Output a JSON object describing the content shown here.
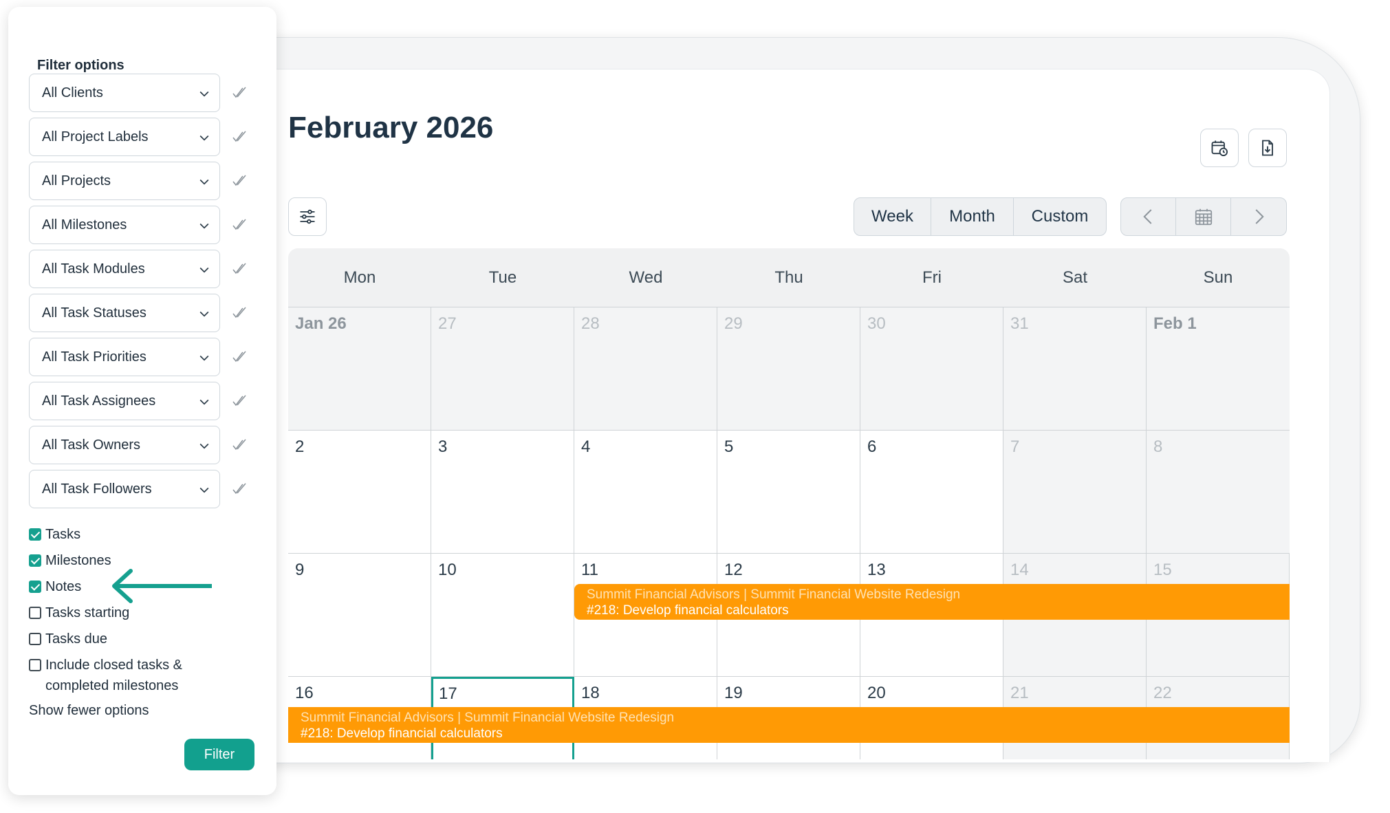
{
  "calendar": {
    "title": "February 2026",
    "views": [
      "Week",
      "Month",
      "Custom"
    ],
    "weekdays": [
      "Mon",
      "Tue",
      "Wed",
      "Thu",
      "Fri",
      "Sat",
      "Sun"
    ],
    "weeks": [
      [
        "Jan 26",
        "27",
        "28",
        "29",
        "30",
        "31",
        "Feb 1"
      ],
      [
        "2",
        "3",
        "4",
        "5",
        "6",
        "7",
        "8"
      ],
      [
        "9",
        "10",
        "11",
        "12",
        "13",
        "14",
        "15"
      ],
      [
        "16",
        "17",
        "18",
        "19",
        "20",
        "21",
        "22"
      ]
    ],
    "events": [
      {
        "line1": "Summit Financial Advisors | Summit Financial Website Redesign",
        "line2": "#218: Develop financial calculators"
      },
      {
        "line1": "Summit Financial Advisors | Summit Financial Website Redesign",
        "line2": "#218: Develop financial calculators"
      }
    ]
  },
  "filters": {
    "title": "Filter options",
    "selects": [
      "All Clients",
      "All Project Labels",
      "All Projects",
      "All Milestones",
      "All Task Modules",
      "All Task Statuses",
      "All Task Priorities",
      "All Task Assignees",
      "All Task Owners",
      "All Task Followers"
    ],
    "checkboxes": [
      {
        "label": "Tasks",
        "checked": true
      },
      {
        "label": "Milestones",
        "checked": true
      },
      {
        "label": "Notes",
        "checked": true
      },
      {
        "label": "Tasks starting",
        "checked": false
      },
      {
        "label": "Tasks due",
        "checked": false
      },
      {
        "label": "Include closed tasks & completed milestones",
        "checked": false
      }
    ],
    "show_fewer": "Show fewer options",
    "filter_button": "Filter"
  },
  "colors": {
    "accent": "#15a08f",
    "event": "#ff9a05"
  }
}
